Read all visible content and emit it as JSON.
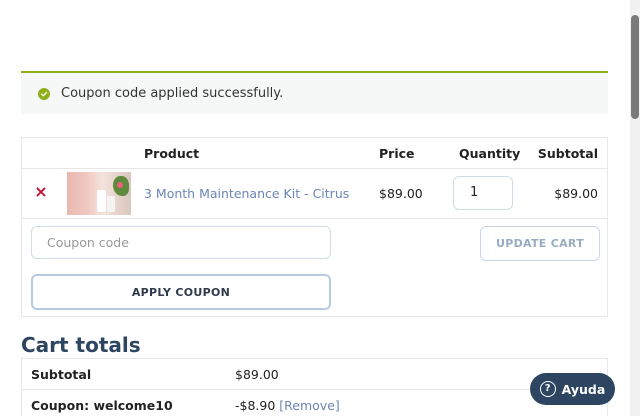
{
  "notice": {
    "message": "Coupon code applied successfully.",
    "icon": "check-circle-icon",
    "color": "#8fae1b"
  },
  "cart": {
    "headers": {
      "product": "Product",
      "price": "Price",
      "quantity": "Quantity",
      "subtotal": "Subtotal"
    },
    "items": [
      {
        "name": "3 Month Maintenance Kit - Citrus",
        "price": "$89.00",
        "quantity": "1",
        "subtotal": "$89.00"
      }
    ],
    "coupon_placeholder": "Coupon code",
    "update_cart_label": "UPDATE CART",
    "apply_coupon_label": "APPLY COUPON"
  },
  "totals": {
    "title": "Cart totals",
    "rows": [
      {
        "label": "Subtotal",
        "value": "$89.00"
      },
      {
        "label": "Coupon: welcome10",
        "value": "-$8.90",
        "action": "[Remove]"
      }
    ]
  },
  "help": {
    "label": "Ayuda",
    "icon": "question-circle-icon"
  },
  "colors": {
    "accent": "#8fae1b",
    "link": "#6b86b3",
    "primary_dark": "#2d4560",
    "remove": "#c8102e"
  }
}
